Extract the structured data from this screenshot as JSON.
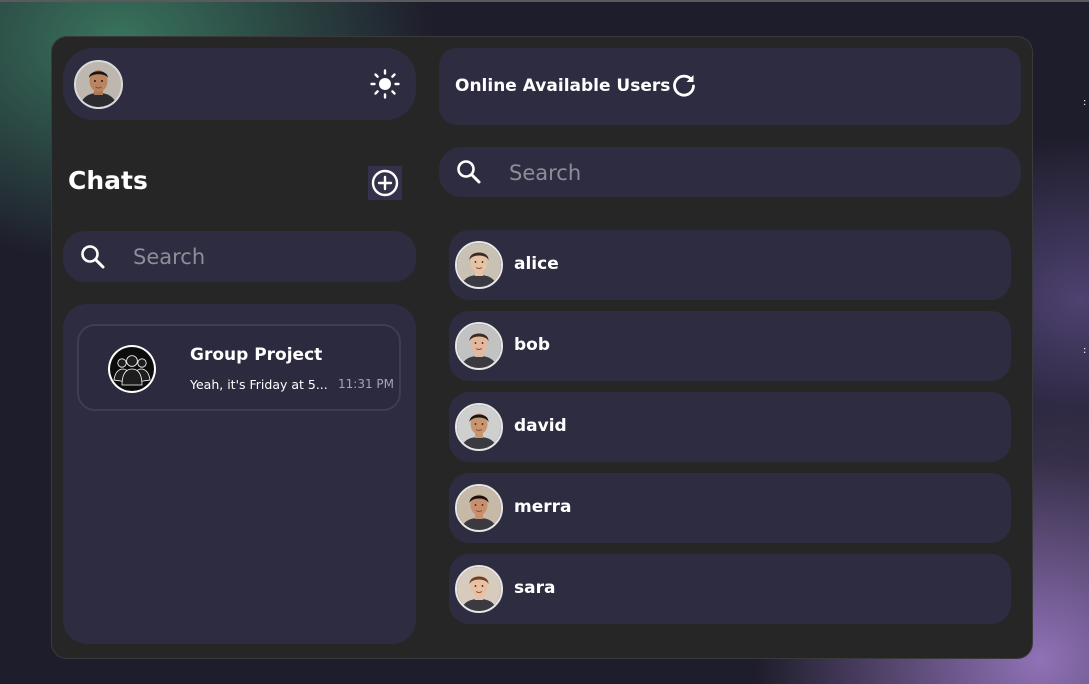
{
  "profile": {
    "avatar_icon": "user-avatar",
    "theme_icon": "sun-icon"
  },
  "sidebar": {
    "title": "Chats",
    "add_icon": "plus-circle-icon",
    "search_placeholder": "Search",
    "chats": [
      {
        "name": "Group Project",
        "preview": "Yeah, it's Friday at 5...",
        "time": "11:31 PM",
        "icon": "group-icon"
      }
    ]
  },
  "online": {
    "title": "Online Available Users",
    "refresh_icon": "refresh-icon",
    "search_placeholder": "Search",
    "users": [
      {
        "name": "alice",
        "skin": "#e7c3a6",
        "hair": "#3a2a22",
        "bg": "#c8c1b4"
      },
      {
        "name": "bob",
        "skin": "#e3b89c",
        "hair": "#3b2b20",
        "bg": "#c2c2c2"
      },
      {
        "name": "david",
        "skin": "#c8956f",
        "hair": "#1c1410",
        "bg": "#cfcfcf"
      },
      {
        "name": "merra",
        "skin": "#c98f6d",
        "hair": "#1a1210",
        "bg": "#c6b9a8"
      },
      {
        "name": "sara",
        "skin": "#e9c0a2",
        "hair": "#6a3f2a",
        "bg": "#d7cbbd"
      }
    ]
  },
  "colors": {
    "panel": "#2e2c40",
    "frame": "#262626",
    "text": "#ffffff",
    "muted": "#8f8d99"
  }
}
